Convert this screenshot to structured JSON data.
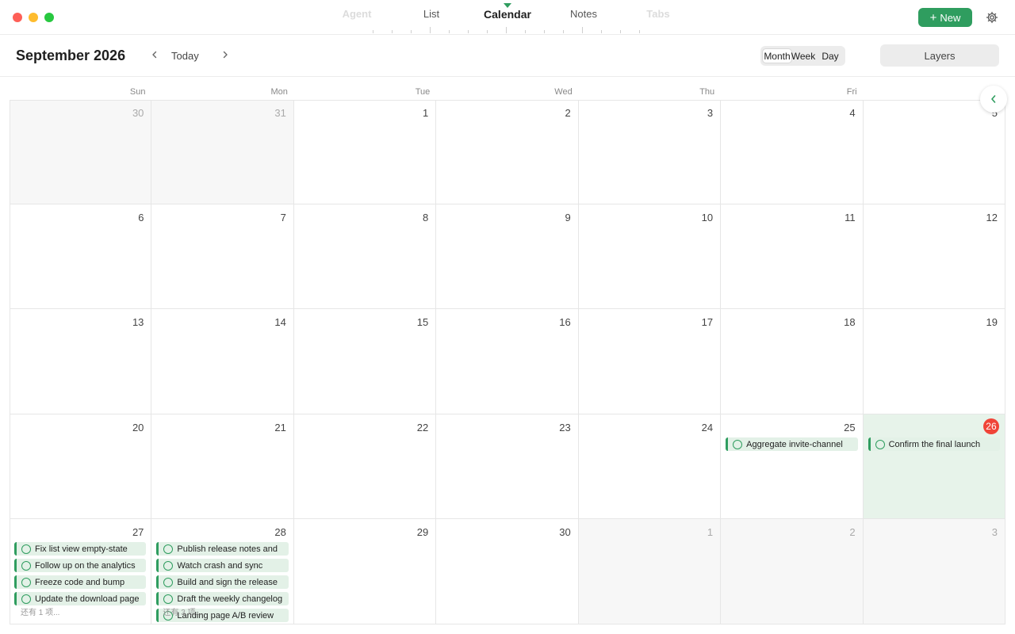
{
  "window": {
    "new_label": "New"
  },
  "view_tabs": [
    {
      "label": "Agent",
      "ghost": true
    },
    {
      "label": "List",
      "ghost": false
    },
    {
      "label": "Calendar",
      "ghost": false,
      "active": true
    },
    {
      "label": "Notes",
      "ghost": false
    },
    {
      "label": "Tabs",
      "ghost": true
    }
  ],
  "toolbar": {
    "title": "September 2026",
    "today_label": "Today",
    "view_modes": [
      "Month",
      "Week",
      "Day"
    ],
    "selected_mode": "Month",
    "layers_label": "Layers"
  },
  "weekdays": [
    "Sun",
    "Mon",
    "Tue",
    "Wed",
    "Thu",
    "Fri",
    "Sat"
  ],
  "colors": {
    "accent": "#2f9d5f",
    "today_badge": "#f04438",
    "today_bg": "#e7f3ea",
    "event_bg": "#e3f1e7"
  },
  "weeks": [
    [
      {
        "n": "30",
        "muted": true
      },
      {
        "n": "31",
        "muted": true
      },
      {
        "n": "1"
      },
      {
        "n": "2"
      },
      {
        "n": "3"
      },
      {
        "n": "4"
      },
      {
        "n": "5"
      }
    ],
    [
      {
        "n": "6"
      },
      {
        "n": "7"
      },
      {
        "n": "8"
      },
      {
        "n": "9"
      },
      {
        "n": "10"
      },
      {
        "n": "11"
      },
      {
        "n": "12"
      }
    ],
    [
      {
        "n": "13"
      },
      {
        "n": "14"
      },
      {
        "n": "15"
      },
      {
        "n": "16"
      },
      {
        "n": "17"
      },
      {
        "n": "18"
      },
      {
        "n": "19"
      }
    ],
    [
      {
        "n": "20"
      },
      {
        "n": "21"
      },
      {
        "n": "22"
      },
      {
        "n": "23"
      },
      {
        "n": "24"
      },
      {
        "n": "25",
        "events": [
          "Aggregate invite-channel"
        ]
      },
      {
        "n": "26",
        "today": true,
        "events": [
          "Confirm the final launch"
        ]
      }
    ],
    [
      {
        "n": "27",
        "events": [
          "Fix list view empty-state",
          "Follow up on the analytics",
          "Freeze code and bump",
          "Update the download page"
        ],
        "more": "还有 1 项..."
      },
      {
        "n": "28",
        "events": [
          "Publish release notes and",
          "Watch crash and sync",
          "Build and sign the release",
          "Draft the weekly changelog",
          "Landing page A/B review"
        ],
        "more": "还有 3 项..."
      },
      {
        "n": "29"
      },
      {
        "n": "30"
      },
      {
        "n": "1",
        "muted": true
      },
      {
        "n": "2",
        "muted": true
      },
      {
        "n": "3",
        "muted": true
      }
    ]
  ]
}
